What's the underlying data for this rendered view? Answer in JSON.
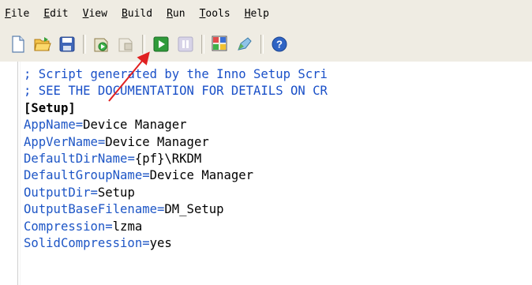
{
  "menu": {
    "items": [
      {
        "underline": "F",
        "rest": "ile"
      },
      {
        "underline": "E",
        "rest": "dit"
      },
      {
        "underline": "V",
        "rest": "iew"
      },
      {
        "underline": "B",
        "rest": "uild"
      },
      {
        "underline": "R",
        "rest": "un"
      },
      {
        "underline": "T",
        "rest": "ools"
      },
      {
        "underline": "H",
        "rest": "elp"
      }
    ]
  },
  "toolbar": {
    "buttons": [
      "new-icon",
      "open-icon",
      "save-icon",
      "compile-icon",
      "stop-compile-icon",
      "run-icon",
      "pause-icon",
      "wizard-icon",
      "edit-icon",
      "help-icon"
    ]
  },
  "editor": {
    "comment1": "; Script generated by the Inno Setup Scri",
    "comment2": "; SEE THE DOCUMENTATION FOR DETAILS ON CR",
    "section": "[Setup]",
    "entries": [
      {
        "key": "AppName",
        "value": "Device Manager"
      },
      {
        "key": "AppVerName",
        "value": "Device Manager"
      },
      {
        "key": "DefaultDirName",
        "value": "{pf}\\RKDM"
      },
      {
        "key": "DefaultGroupName",
        "value": "Device Manager"
      },
      {
        "key": "OutputDir",
        "value": "Setup"
      },
      {
        "key": "OutputBaseFilename",
        "value": "DM_Setup"
      },
      {
        "key": "Compression",
        "value": "lzma"
      },
      {
        "key": "SolidCompression",
        "value": "yes"
      }
    ]
  }
}
